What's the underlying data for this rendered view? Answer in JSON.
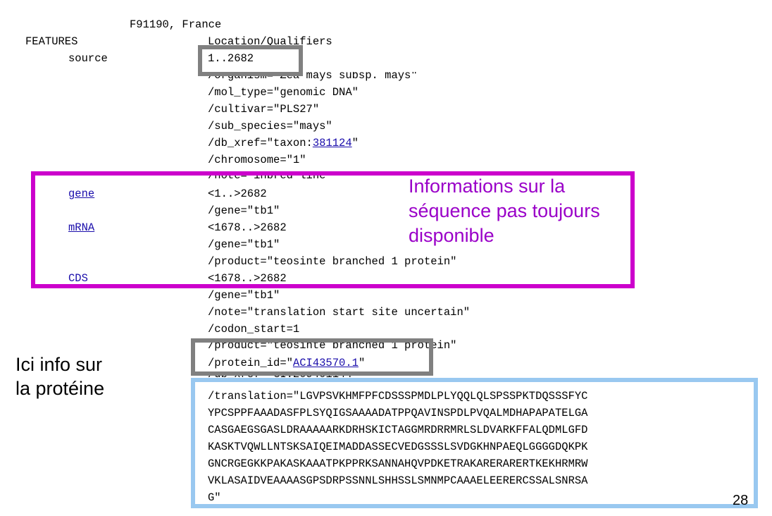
{
  "header_line": "F91190, France",
  "features_label": "FEATURES",
  "location_header": "Location/Qualifiers",
  "source": {
    "key": "source",
    "location": "1..2682",
    "qualifiers": {
      "organism": "/organism=\"Zea mays subsp. mays\"",
      "mol_type": "/mol_type=\"genomic DNA\"",
      "cultivar": "/cultivar=\"PLS27\"",
      "sub_species": "/sub_species=\"mays\"",
      "db_xref_prefix": "/db_xref=\"taxon:",
      "db_xref_link": "381124",
      "db_xref_suffix": "\"",
      "chromosome": "/chromosome=\"1\"",
      "note": "/note=\"inbred line\""
    }
  },
  "gene": {
    "key": "gene",
    "location": "<1..>2682",
    "gene": "/gene=\"tb1\""
  },
  "mrna": {
    "key": "mRNA",
    "location": "<1678..>2682",
    "gene": "/gene=\"tb1\"",
    "product": "/product=\"teosinte branched 1 protein\""
  },
  "cds": {
    "key": "CDS",
    "location": "<1678..>2682",
    "gene": "/gene=\"tb1\"",
    "note": "/note=\"translation start site uncertain\"",
    "codon_start": "/codon_start=1",
    "product": "/product=\"teosinte branched 1 protein\"",
    "protein_id_prefix": "/protein_id=\"",
    "protein_id_link": "ACI43570.1",
    "protein_id_suffix": "\"",
    "db_xref": "/db_xref=\"GI:209401144\"",
    "translation_lines": [
      "/translation=\"LGVPSVKHMFPFCDSSSPMDLPLYQQLQLSPSSPKTDQSSSFYC",
      "YPCSPPFAAADASFPLSYQIGSAAAADATPPQAVINSPDLPVQALMDHAPAPATELGA",
      "CASGAEGSGASLDRAAAAARKDRHSKICTAGGMRDRRMRLSLDVARKFFALQDMLGFD",
      "KASKTVQWLLNTSKSAIQEIMADDASSECVEDGSSSLSVDGKHNPAEQLGGGGDQKPK",
      "GNCRGEGKKPAKASKAAATPKPPRKSANNAHQVPDKETRAKARERARERTKEKHRMRW",
      "VKLASAIDVEAAAASGPSDRPSSNNLSHHSSLSMNMPCAAAELEERERCSSALSNRSA",
      "G\""
    ]
  },
  "annotations": {
    "purple_text": [
      "Informations sur la",
      "séquence pas toujours",
      "disponible"
    ],
    "protein_text": [
      "Ici info sur",
      "la protéine"
    ]
  },
  "page_number": "28",
  "colors": {
    "purple": "#cc00cc",
    "purple_text": "#9a00c8",
    "gray": "#808080",
    "light_blue": "#99c8f0",
    "link": "#1a0dab"
  }
}
